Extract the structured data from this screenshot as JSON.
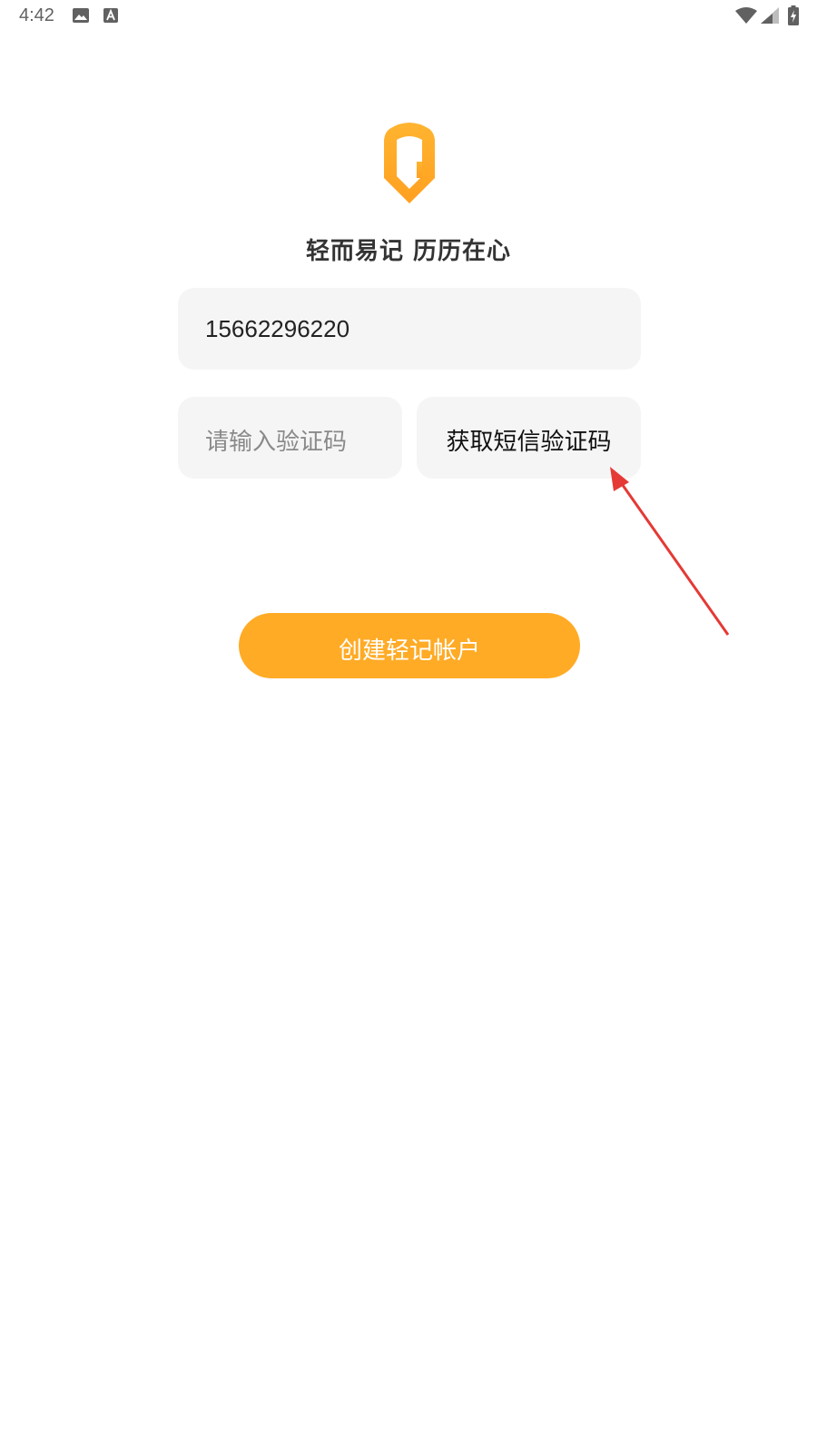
{
  "status_bar": {
    "time": "4:42",
    "icons": [
      "image-icon",
      "a-box-icon",
      "wifi-icon",
      "cell-signal-icon",
      "battery-charging-icon"
    ]
  },
  "logo": {
    "icon": "app-logo-icon",
    "color": "#FFAB26"
  },
  "slogan": "轻而易记 历历在心",
  "phone_field": {
    "value": "15662296220"
  },
  "code_field": {
    "placeholder": "请输入验证码"
  },
  "sms_button": {
    "label": "获取短信验证码"
  },
  "create_button": {
    "label": "创建轻记帐户",
    "color": "#FFAB26"
  },
  "annotation": {
    "color": "#E53935",
    "icon": "arrow-icon"
  }
}
